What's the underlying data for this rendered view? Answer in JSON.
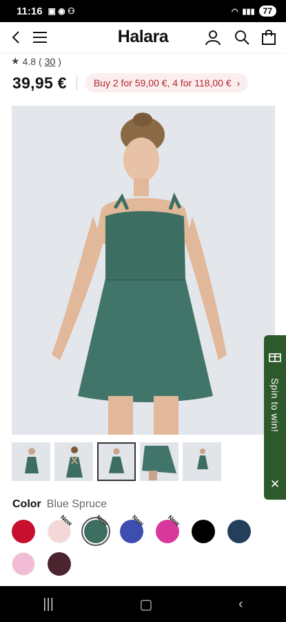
{
  "status": {
    "time": "11:16",
    "battery": "77"
  },
  "header": {
    "logo": "Halara"
  },
  "rating": {
    "value": "4.8",
    "count": "30"
  },
  "price": {
    "amount": "39,95 €",
    "promo": "Buy 2 for 59,00 €, 4 for 118,00 €"
  },
  "thumbnails": {
    "count": 5,
    "selected_index": 2
  },
  "color": {
    "label": "Color",
    "selected": "Blue Spruce"
  },
  "swatches": [
    {
      "color": "#c8102e",
      "tag": ""
    },
    {
      "color": "#f4d7d7",
      "tag": "New"
    },
    {
      "color": "#3d6e62",
      "tag": "New",
      "selected": true
    },
    {
      "color": "#3e4db0",
      "tag": "New"
    },
    {
      "color": "#d8389a",
      "tag": "New"
    },
    {
      "color": "#000000",
      "tag": ""
    },
    {
      "color": "#233f5c",
      "tag": ""
    },
    {
      "color": "#f2bcd6",
      "tag": ""
    },
    {
      "color": "#4a2530",
      "tag": ""
    }
  ],
  "spin": {
    "label": "Spin to win!"
  },
  "accent": {
    "promo_text": "#b3262b",
    "spin_bg": "#2d5a2a",
    "dress": "#3d6e62"
  }
}
